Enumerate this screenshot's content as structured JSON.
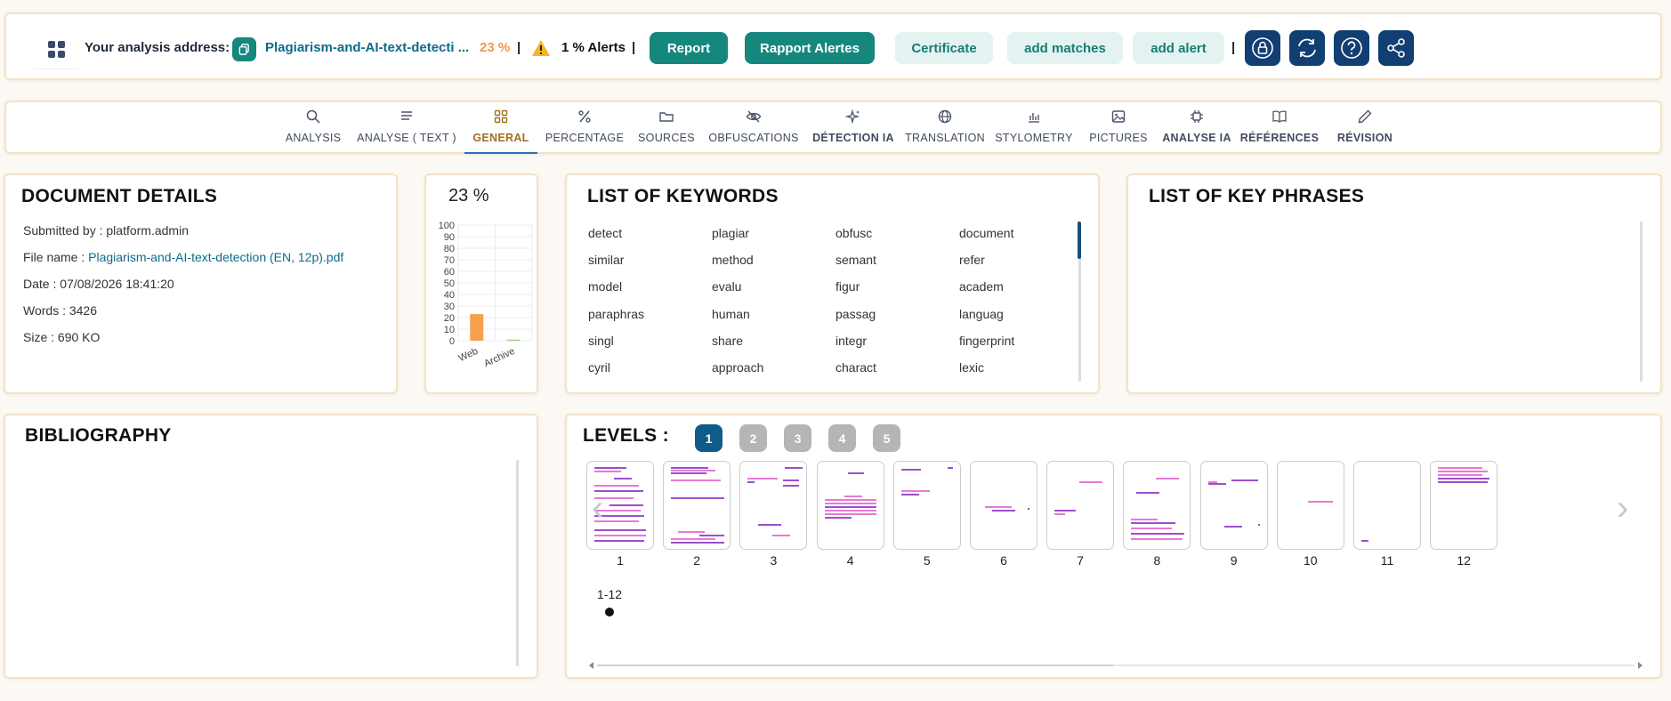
{
  "topbar": {
    "address_label": "Your analysis address:",
    "document_link": "Plagiarism-and-AI-text-detecti ...",
    "percent": "23 %",
    "separator": "|",
    "alerts": "1 % Alerts",
    "buttons": {
      "report": "Report",
      "rapport_alertes": "Rapport Alertes",
      "certificate": "Certificate",
      "add_matches": "add matches",
      "add_alert": "add alert"
    },
    "icons": [
      "lock-icon",
      "refresh-icon",
      "help-icon",
      "share-icon"
    ]
  },
  "tabs": [
    {
      "label": "ANALYSIS",
      "icon": "search-icon"
    },
    {
      "label": "ANALYSE ( TEXT )",
      "icon": "text-lines-icon"
    },
    {
      "label": "GENERAL",
      "icon": "grid-icon",
      "active": true
    },
    {
      "label": "PERCENTAGE",
      "icon": "percent-icon"
    },
    {
      "label": "SOURCES",
      "icon": "folder-icon"
    },
    {
      "label": "OBFUSCATIONS",
      "icon": "eye-off-icon"
    },
    {
      "label": "DÉTECTION IA",
      "icon": "sparkles-icon"
    },
    {
      "label": "TRANSLATION",
      "icon": "globe-icon"
    },
    {
      "label": "STYLOMETRY",
      "icon": "bar-chart-icon"
    },
    {
      "label": "PICTURES",
      "icon": "image-icon"
    },
    {
      "label": "ANALYSE IA",
      "icon": "chip-icon"
    },
    {
      "label": "RÉFÉRENCES",
      "icon": "book-icon"
    },
    {
      "label": "RÉVISION",
      "icon": "pencil-icon"
    }
  ],
  "document_details": {
    "title": "DOCUMENT DETAILS",
    "submitted_by_label": "Submitted by : ",
    "submitted_by": "platform.admin",
    "file_name_label": "File name : ",
    "file_name": "Plagiarism-and-AI-text-detection (EN, 12p).pdf",
    "date": "Date : 07/08/2026 18:41:20",
    "words": "Words : 3426",
    "size": "Size : 690 KO"
  },
  "chart_card": {
    "percent": "23 %"
  },
  "chart_data": {
    "type": "bar",
    "categories": [
      "Web",
      "Archive"
    ],
    "values": [
      23,
      1
    ],
    "colors": [
      "#f6a04d",
      "#9bd17b"
    ],
    "yticks": [
      0,
      10,
      20,
      30,
      40,
      50,
      60,
      70,
      80,
      90,
      100
    ],
    "ylim": [
      0,
      100
    ],
    "grid": true
  },
  "keywords": {
    "title": "LIST OF KEYWORDS",
    "items": [
      "detect",
      "plagiar",
      "obfusc",
      "document",
      "similar",
      "method",
      "semant",
      "refer",
      "model",
      "evalu",
      "figur",
      "academ",
      "paraphras",
      "human",
      "passag",
      "languag",
      "singl",
      "share",
      "integr",
      "fingerprint",
      "cyril",
      "approach",
      "charact",
      "lexic"
    ]
  },
  "key_phrases": {
    "title": "LIST OF KEY PHRASES"
  },
  "bibliography": {
    "title": "BIBLIOGRAPHY"
  },
  "levels": {
    "title": "LEVELS :",
    "badges": [
      "1",
      "2",
      "3",
      "4",
      "5"
    ],
    "active": "1",
    "pages": [
      "1",
      "2",
      "3",
      "4",
      "5",
      "6",
      "7",
      "8",
      "9",
      "10",
      "11",
      "12"
    ],
    "range": "1-12"
  },
  "colors": {
    "teal": "#15877d",
    "navy": "#123f72",
    "orange": "#f2994a",
    "link": "#0e6b8a",
    "highlight_pink": "#e879d6",
    "highlight_purple": "#9b4fd0"
  }
}
